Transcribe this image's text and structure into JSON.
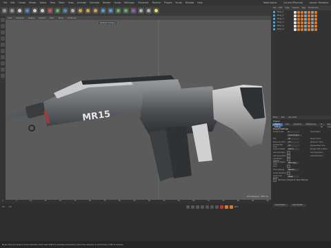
{
  "menubar": {
    "items": [
      "File",
      "Edit",
      "Create",
      "Modes",
      "Select",
      "Tools",
      "Mesh",
      "Snap",
      "Animate",
      "Simulate",
      "Render",
      "Sculpt",
      "MoGraph",
      "Character",
      "Pipeline",
      "Plugins",
      "Script",
      "Window",
      "Help"
    ],
    "right": [
      "Node Space:",
      "Current (Physical)",
      "Layout: Standard"
    ]
  },
  "viewport": {
    "menu": [
      "View",
      "Cameras",
      "Display",
      "Options",
      "Filter",
      "Panel",
      "ProRender"
    ],
    "camera_label": "Default Camera",
    "grid_spacing": "Grid Spacing : 100 cm",
    "rifle_text": "MR15"
  },
  "timeline": {
    "ticks": [
      "0",
      "5",
      "10",
      "15",
      "20",
      "25",
      "30",
      "35",
      "40",
      "45",
      "50",
      "55",
      "60",
      "65",
      "70",
      "75",
      "80",
      "85",
      "90"
    ],
    "start": "0 F",
    "end": "90 F",
    "current": "0 F"
  },
  "status": "Move: Click and drag to move elements. Hold down SHIFT to quantize movement / add to the selection in point mode, CTRL to remove.",
  "object_manager": {
    "menu": [
      "File",
      "Edit",
      "View",
      "Objects",
      "Tags",
      "Bookmarks"
    ],
    "objects": [
      "Body_1",
      "Body_2",
      "Body_3",
      "Body_4",
      "Body_5",
      "Body_6"
    ]
  },
  "attributes": {
    "menu": [
      "Mode",
      "Edit",
      "User Data"
    ],
    "title": "Project",
    "tabs": [
      "Project Settings",
      "Info",
      "Dynamics",
      "Referencing",
      "To Do",
      "Key Interpolation"
    ],
    "section": "Project Settings",
    "scale_label": "Project Scale",
    "scale_value": "1",
    "scale_unit": "Centimeters",
    "scale_button": "Scale Project...",
    "rows": [
      {
        "label": "FPS",
        "value": "30",
        "right": "Project Time"
      },
      {
        "label": "Minimum Time",
        "value": "0 F",
        "right": "Maximum Time"
      },
      {
        "label": "Preview Min Time",
        "value": "0 F",
        "right": "Preview Max Time"
      },
      {
        "label": "Level of Detail",
        "value": "100 %",
        "right": "Render LOD in Editor"
      },
      {
        "label": "Use Animation",
        "value": "",
        "right": "Use Expression"
      },
      {
        "label": "Use Generators",
        "value": "",
        "right": "Use Deformers"
      },
      {
        "label": "Use Motion System",
        "value": "",
        "right": ""
      },
      {
        "label": "Default Object Color",
        "value": "80% Gray",
        "right": ""
      },
      {
        "label": "Color",
        "value": "",
        "right": ""
      },
      {
        "label": "View Clipping",
        "value": "Medium",
        "right": ""
      },
      {
        "label": "Linear Workflow",
        "value": "",
        "right": ""
      },
      {
        "label": "Input Color Profile",
        "value": "sRGB",
        "right": ""
      }
    ],
    "use_color": "Use Color Channel for Node Material",
    "buttons": [
      "Load Preset...",
      "Save Preset..."
    ]
  }
}
